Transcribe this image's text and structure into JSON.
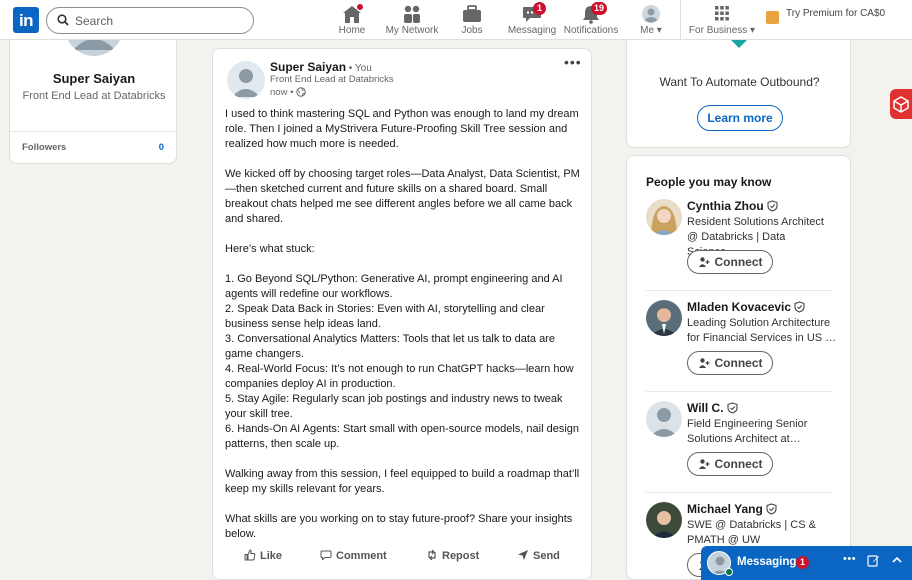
{
  "nav": {
    "search_placeholder": "Search",
    "items": [
      {
        "label": "Home",
        "badge": ""
      },
      {
        "label": "My Network",
        "badge": ""
      },
      {
        "label": "Jobs",
        "badge": ""
      },
      {
        "label": "Messaging",
        "badge": "1"
      },
      {
        "label": "Notifications",
        "badge": "19"
      },
      {
        "label": "Me ▾",
        "badge": ""
      },
      {
        "label": "For Business ▾",
        "badge": ""
      }
    ],
    "premium": "Try Premium for CA$0"
  },
  "profile": {
    "name": "Super Saiyan",
    "headline": "Front End Lead at Databricks",
    "followers_label": "Followers",
    "followers_value": "0"
  },
  "post": {
    "author": "Super Saiyan",
    "you_tag": " • You",
    "subtitle": "Front End Lead at Databricks",
    "time": "now •",
    "more": "•••",
    "body": "I used to think mastering SQL and Python was enough to land my dream role. Then I joined a MyStrivera Future-Proofing Skill Tree session and realized how much more is needed.\n\nWe kicked off by choosing target roles—Data Analyst, Data Scientist, PM—then sketched current and future skills on a shared board. Small breakout chats helped me see different angles before we all came back and shared.\n\nHere’s what stuck:\n\n1. Go Beyond SQL/Python: Generative AI, prompt engineering and AI agents will redefine our workflows.\n2. Speak Data Back in Stories: Even with AI, storytelling and clear business sense help ideas land.\n3. Conversational Analytics Matters: Tools that let us talk to data are game changers.\n4. Real-World Focus: It’s not enough to run ChatGPT hacks—learn how companies deploy AI in production.\n5. Stay Agile: Regularly scan job postings and industry news to tweak your skill tree.\n6. Hands-On AI Agents: Start small with open-source models, nail design patterns, then scale up.\n\nWalking away from this session, I feel equipped to build a roadmap that’ll keep my skills relevant for years.\n\nWhat skills are you working on to stay future-proof? Share your insights below.",
    "actions": [
      "Like",
      "Comment",
      "Repost",
      "Send"
    ]
  },
  "promo": {
    "question": "Want To Automate Outbound?",
    "button": "Learn more"
  },
  "pymk": {
    "title": "People you may know",
    "connect_label": "Connect",
    "people": [
      {
        "name": "Cynthia Zhou",
        "headline": "Resident Solutions Architect @ Databricks | Data Science…"
      },
      {
        "name": "Mladen Kovacevic",
        "headline": "Leading Solution Architecture for Financial Services in US …"
      },
      {
        "name": "Will C.",
        "headline": "Field Engineering Senior Solutions Architect at…"
      },
      {
        "name": "Michael Yang",
        "headline": "SWE @ Databricks | CS & PMATH @ UW"
      }
    ]
  },
  "messaging": {
    "title": "Messaging",
    "badge": "1",
    "more": "•••"
  },
  "colors": {
    "brand": "#0a66c2",
    "badge": "#cb112d",
    "page_bg": "#f4f2ee"
  }
}
